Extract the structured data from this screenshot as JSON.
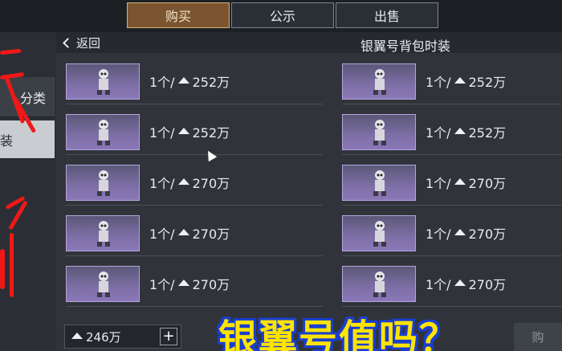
{
  "top_tabs": [
    {
      "label": "购买",
      "active": true
    },
    {
      "label": "公示",
      "active": false
    },
    {
      "label": "出售",
      "active": false
    }
  ],
  "sidebar": {
    "category_label": "分类",
    "selected_item_label": "装"
  },
  "panel": {
    "back_label": "返回",
    "title": "银翼号背包时装"
  },
  "listings": [
    {
      "qty": "1个/",
      "price": "252万"
    },
    {
      "qty": "1个/",
      "price": "252万"
    },
    {
      "qty": "1个/",
      "price": "252万"
    },
    {
      "qty": "1个/",
      "price": "252万"
    },
    {
      "qty": "1个/",
      "price": "270万"
    },
    {
      "qty": "1个/",
      "price": "270万"
    },
    {
      "qty": "1个/",
      "price": "270万"
    },
    {
      "qty": "1个/",
      "price": "270万"
    },
    {
      "qty": "1个/",
      "price": "270万"
    },
    {
      "qty": "1个/",
      "price": "270万"
    }
  ],
  "footer": {
    "balance": "246万",
    "buy_label": "购"
  },
  "overlay": {
    "caption": "银翼号值吗？"
  },
  "colors": {
    "active_tab": "#7a5530",
    "caption_fill": "#ffe400",
    "caption_outline": "#1a3fd0",
    "annotation_red": "#f01818",
    "item_bg": "#8a78b8"
  },
  "icons": [
    "chevron-left-icon",
    "coin-icon",
    "plus-icon",
    "cursor-icon"
  ]
}
